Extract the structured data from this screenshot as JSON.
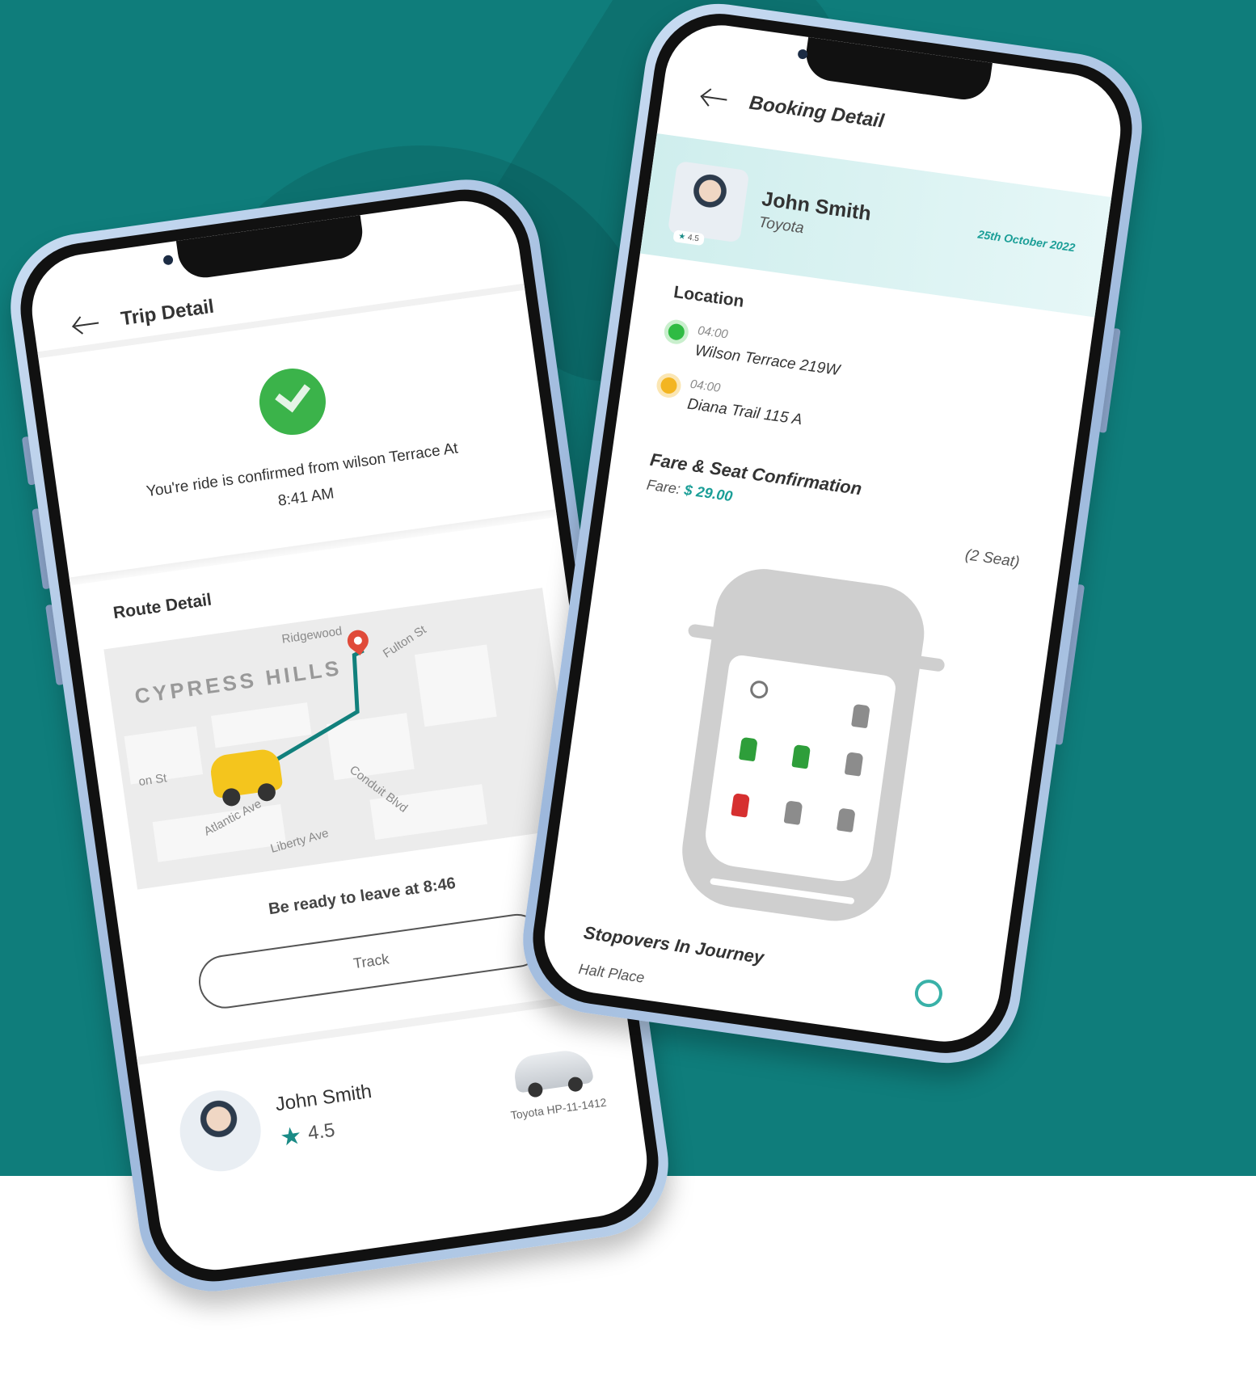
{
  "left_phone": {
    "header_title": "Trip Detail",
    "confirmation_text": "You're ride is confirmed from wilson Terrace At 8:41 AM",
    "route_section_title": "Route Detail",
    "map_labels": {
      "neighborhood": "CYPRESS HILLS",
      "street_1": "Ridgewood",
      "street_2": "Fulton St",
      "street_3": "on St",
      "street_4": "Atlantic Ave",
      "street_5": "Conduit Blvd",
      "street_6": "Liberty Ave"
    },
    "ready_text": "Be ready to leave at 8:46",
    "track_button": "Track",
    "driver": {
      "name": "John Smith",
      "rating": "4.5",
      "car_model": "Toyota",
      "plate": "HP-11-1412"
    },
    "icons": [
      "back-arrow-icon",
      "check-icon",
      "pin-icon",
      "taxi-icon",
      "star-icon",
      "car-icon"
    ]
  },
  "right_phone": {
    "header_title": "Booking Detail",
    "driver": {
      "name": "John Smith",
      "car": "Toyota",
      "rating": "4.5",
      "date": "25th October 2022"
    },
    "location_title": "Location",
    "stops": [
      {
        "time": "04:00",
        "place": "Wilson Terrace 219W"
      },
      {
        "time": "04:00",
        "place": "Diana Trail 115 A"
      }
    ],
    "fare_title": "Fare & Seat Confirmation",
    "fare_label": "Fare:",
    "fare_value": "$ 29.00",
    "seat_count": "(2 Seat)",
    "stopovers_title": "Stopovers In Journey",
    "halt_label": "Halt Place",
    "colors": {
      "accent": "#1a9e97",
      "seat_booked": "#2e9e3a",
      "seat_unavailable": "#d63030",
      "seat_available": "#8c8c8c"
    },
    "icons": [
      "back-arrow-icon",
      "steering-wheel-icon",
      "seat-icon",
      "clock-icon"
    ]
  }
}
